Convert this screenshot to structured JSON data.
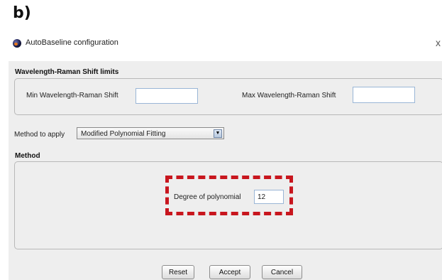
{
  "figure_label": "b)",
  "window": {
    "title": "AutoBaseline configuration",
    "close_glyph": "x",
    "icon": "app-logo-icon"
  },
  "limits_section": {
    "title": "Wavelength-Raman Shift limits",
    "min_label": "Min Wavelength-Raman Shift",
    "min_value": "",
    "max_label": "Max Wavelength-Raman Shift",
    "max_value": ""
  },
  "method_select": {
    "label": "Method to apply",
    "selected": "Modified Polynomial Fitting",
    "arrow_icon": "chevron-down-icon"
  },
  "method_section": {
    "title": "Method",
    "degree_label": "Degree of polynomial",
    "degree_value": "12",
    "highlight_color": "#c8161e"
  },
  "buttons": {
    "reset": "Reset",
    "accept": "Accept",
    "cancel": "Cancel"
  }
}
